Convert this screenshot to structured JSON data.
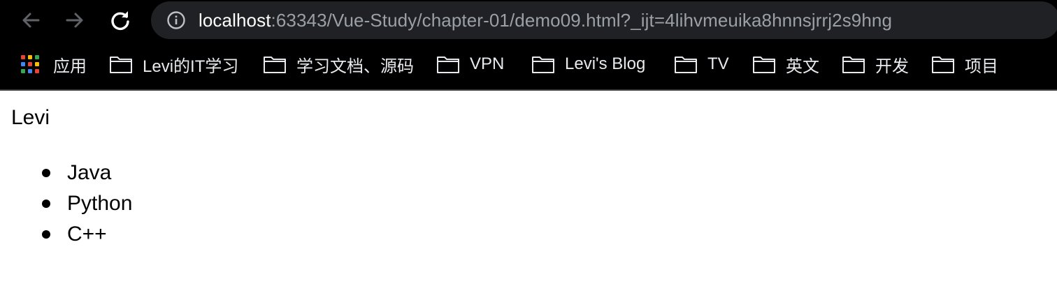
{
  "browser": {
    "url_host": "localhost",
    "url_rest": ":63343/Vue-Study/chapter-01/demo09.html?_ijt=4lihvmeuika8hnnsjrrj2s9hng",
    "icons": {
      "back": "arrow-left-icon",
      "forward": "arrow-right-icon",
      "reload": "reload-icon",
      "site_info": "info-circle-icon",
      "apps": "apps-grid-icon",
      "bookmark_folder": "folder-icon"
    }
  },
  "bookmarks": [
    {
      "label": "应用"
    },
    {
      "label": "Levi的IT学习"
    },
    {
      "label": "学习文档、源码"
    },
    {
      "label": "VPN"
    },
    {
      "label": "Levi's Blog"
    },
    {
      "label": "TV"
    },
    {
      "label": "英文"
    },
    {
      "label": "开发"
    },
    {
      "label": "项目"
    }
  ],
  "page": {
    "name": "Levi",
    "languages": [
      "Java",
      "Python",
      "C++"
    ]
  },
  "colors": {
    "chrome_bg": "#000000",
    "omnibox_bg": "#202124",
    "url_host": "#ffffff",
    "url_rest": "#9aa0a6",
    "nav_disabled": "#5f6368",
    "nav_enabled": "#ffffff",
    "bookmark_text": "#e8eaed",
    "page_bg": "#ffffff",
    "page_text": "#000000"
  }
}
